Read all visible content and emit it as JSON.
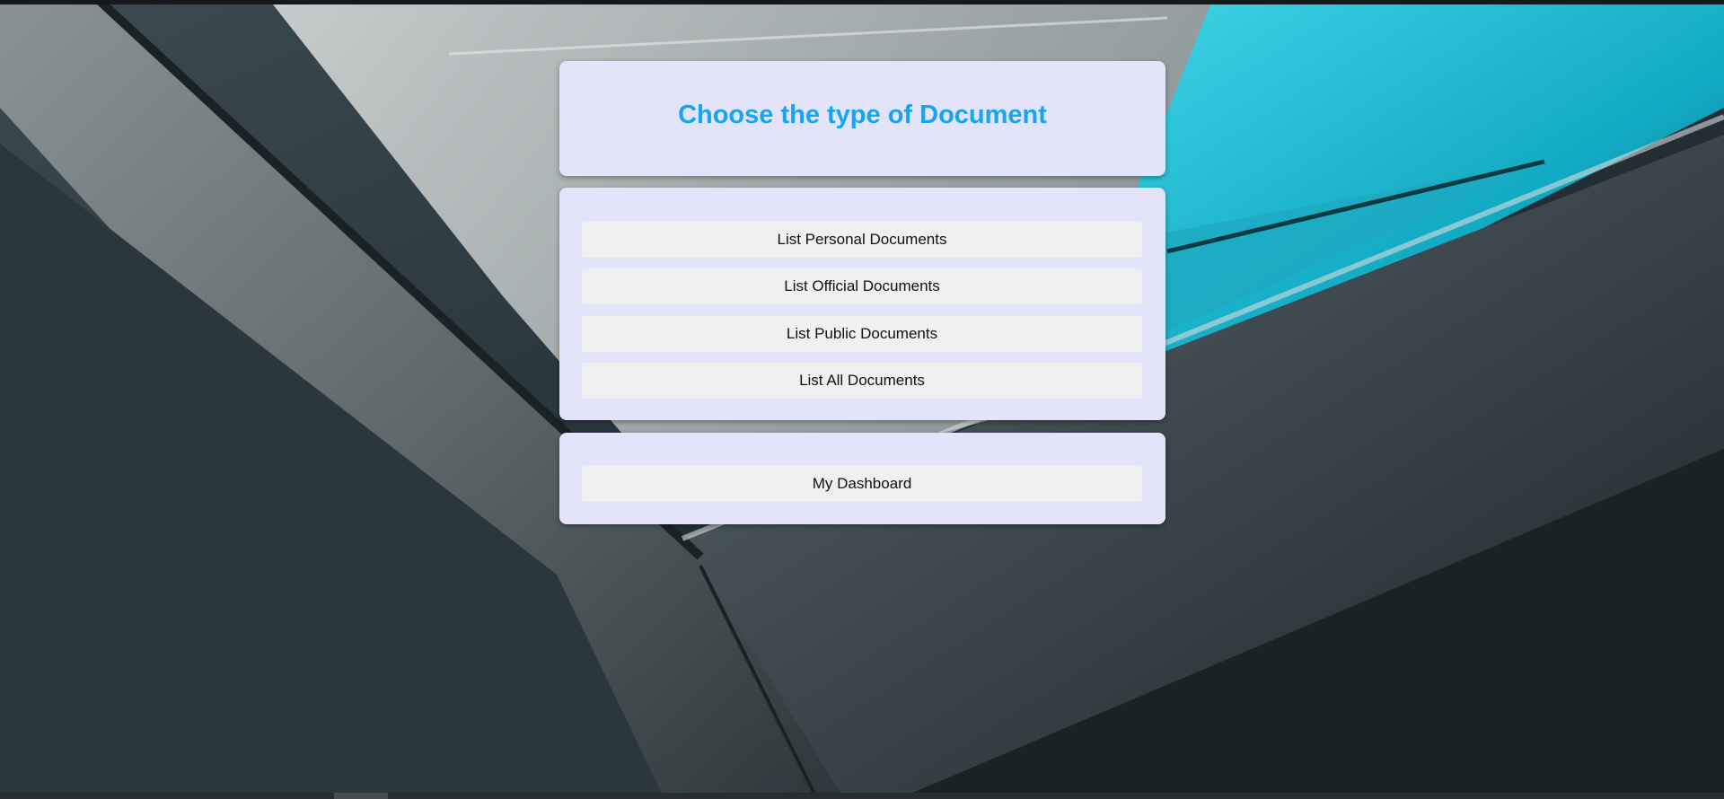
{
  "header": {
    "title": "Choose the type of Document"
  },
  "document_menu": {
    "items": [
      {
        "label": "List Personal Documents"
      },
      {
        "label": "List Official Documents"
      },
      {
        "label": "List Public Documents"
      },
      {
        "label": "List All Documents"
      }
    ]
  },
  "navigation": {
    "dashboard_label": "My Dashboard"
  },
  "colors": {
    "title": "#16a5f4",
    "panel_background": "#e3e3fa",
    "button_background": "#f0f0f0"
  }
}
